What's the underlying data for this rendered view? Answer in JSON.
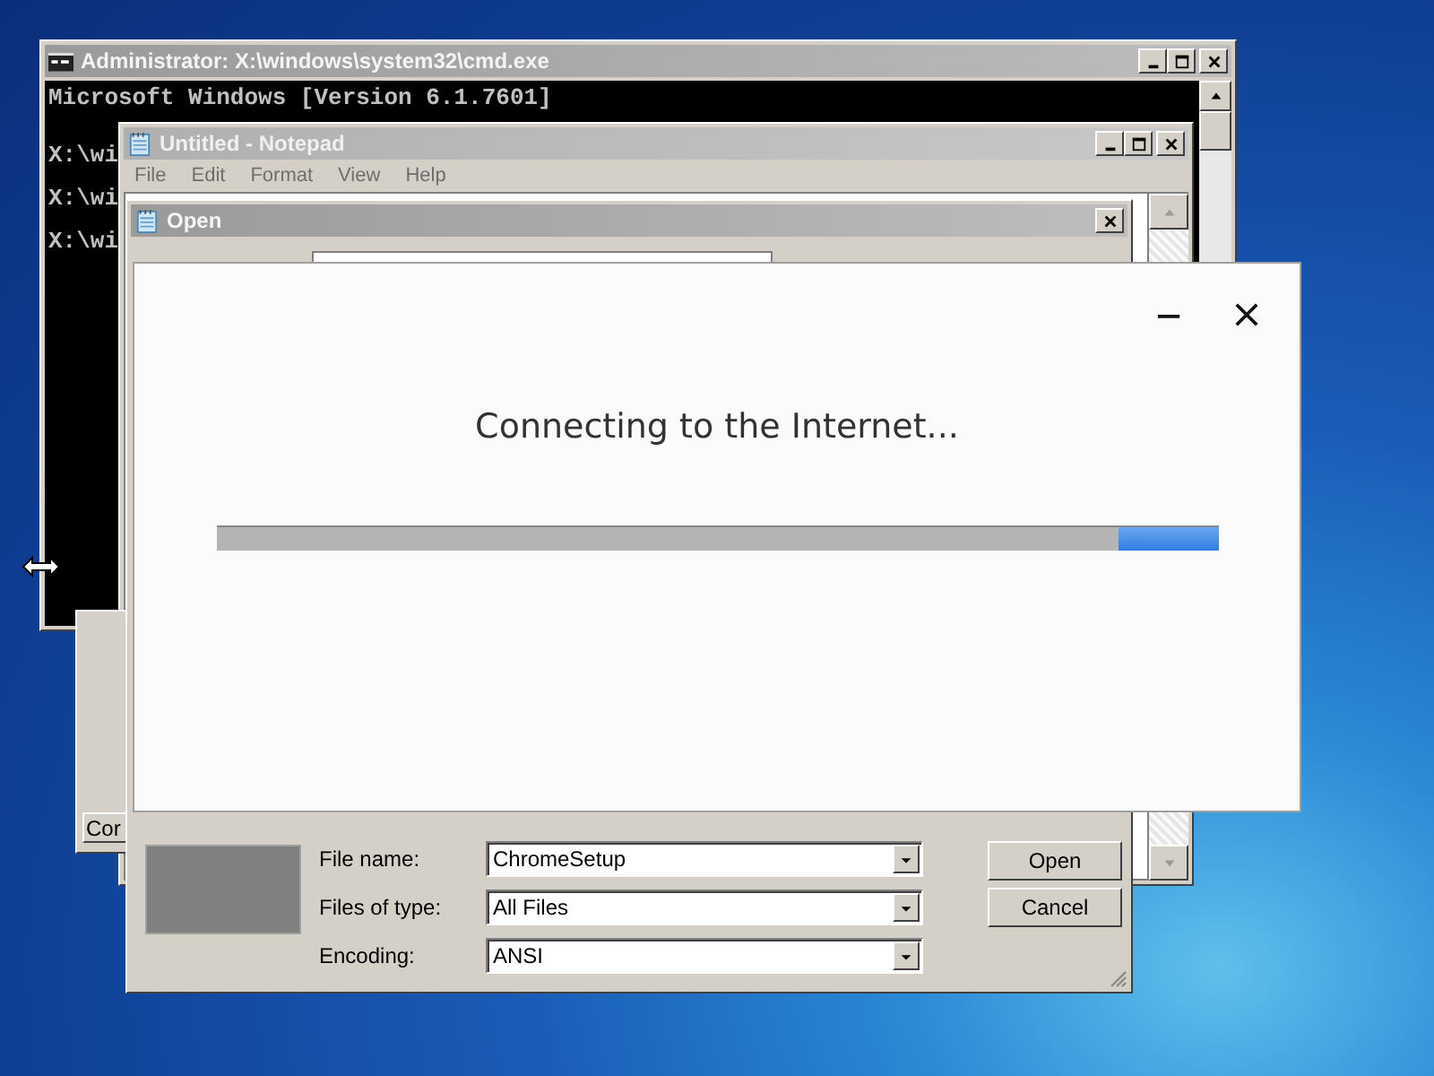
{
  "cmd_window": {
    "title": "Administrator: X:\\windows\\system32\\cmd.exe",
    "lines": [
      "Microsoft Windows [Version 6.1.7601]",
      "X:\\wi",
      "X:\\wi",
      "X:\\wi"
    ]
  },
  "notepad_window": {
    "title": "Untitled - Notepad",
    "menu": [
      "File",
      "Edit",
      "Format",
      "View",
      "Help"
    ]
  },
  "back_window": {
    "button": "Cor"
  },
  "open_dialog": {
    "title": "Open",
    "fields": [
      {
        "label": "File name:",
        "value": "ChromeSetup"
      },
      {
        "label": "Files of type:",
        "value": "All Files"
      },
      {
        "label": "Encoding:",
        "value": "ANSI"
      }
    ],
    "buttons": [
      "Open",
      "Cancel"
    ]
  },
  "installer_dialog": {
    "message": "Connecting to the Internet...",
    "progress": {
      "level": 0.1
    }
  }
}
